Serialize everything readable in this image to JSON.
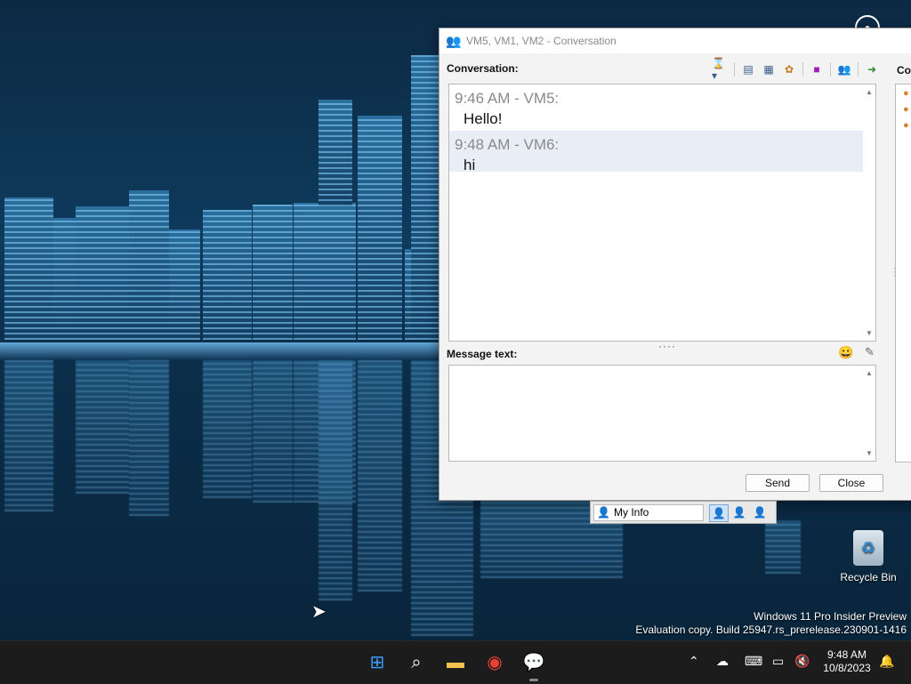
{
  "window": {
    "title": "VM5, VM1, VM2 - Conversation",
    "conversation_label": "Conversation:",
    "message_text_label": "Message text:",
    "right_pane_label": "Co",
    "messages": [
      {
        "header": "9:46 AM - VM5:",
        "body": "Hello!"
      },
      {
        "header": "9:48 AM - VM6:",
        "body": "hi"
      }
    ],
    "message_input_value": "",
    "send_label": "Send",
    "close_label": "Close"
  },
  "myinfo": {
    "label": "My Info"
  },
  "desktop": {
    "recycle_bin_label": "Recycle Bin",
    "watermark_line1": "Windows 11 Pro Insider Preview",
    "watermark_line2": "Evaluation copy. Build 25947.rs_prerelease.230901-1416"
  },
  "taskbar": {
    "time": "9:48 AM",
    "date": "10/8/2023"
  },
  "colors": {
    "accent": "#0078d4",
    "selected_message_bg": "#e9eef6",
    "taskbar_bg": "#1c1c1c"
  }
}
